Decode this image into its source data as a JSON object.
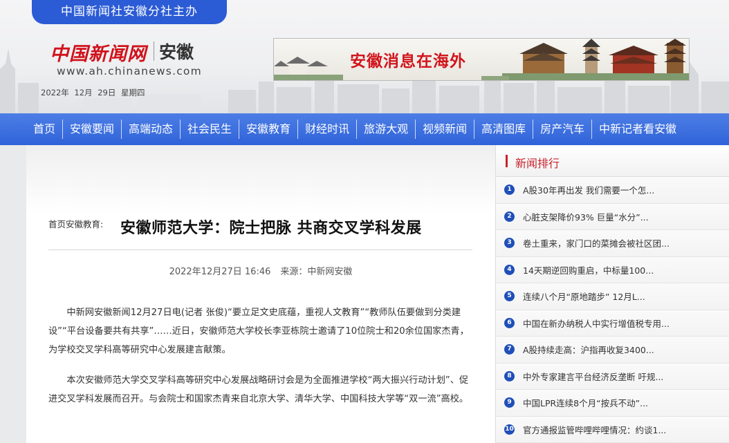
{
  "header": {
    "host_label": "中国新闻社安徽分社主办",
    "logo_cn": "中国新闻网",
    "logo_region": "安徽",
    "logo_url": "www.ah.chinanews.com",
    "date": "2022年 12月 29日",
    "weekday": "星期四"
  },
  "banner": {
    "text": "安徽消息在海外"
  },
  "nav": {
    "items": [
      {
        "label": "首页"
      },
      {
        "label": "安徽要闻"
      },
      {
        "label": "高端动态"
      },
      {
        "label": "社会民生"
      },
      {
        "label": "安徽教育"
      },
      {
        "label": "财经时讯"
      },
      {
        "label": "旅游大观"
      },
      {
        "label": "视频新闻"
      },
      {
        "label": "高清图库"
      },
      {
        "label": "房产汽车"
      },
      {
        "label": "中新记者看安徽"
      }
    ]
  },
  "article": {
    "breadcrumb_home": "首页",
    "breadcrumb_section": "安徽教育",
    "breadcrumb_sep": ":",
    "title": "安徽师范大学：院士把脉 共商交叉学科发展",
    "datetime": "2022年12月27日 16:46",
    "source": "来源：中新网安徽",
    "paragraphs": [
      "中新网安徽新闻12月27日电(记者 张俊)“要立足文史底蕴，重视人文教育”“教师队伍要做到分类建设”“平台设备要共有共享”……近日，安徽师范大学校长李亚栋院士邀请了10位院士和20余位国家杰青，为学校交叉学科高等研究中心发展建言献策。",
      "本次安徽师范大学交叉学科高等研究中心发展战略研讨会是为全面推进学校“两大振兴行动计划”、促进交叉学科发展而召开。与会院士和国家杰青来自北京大学、清华大学、中国科技大学等“双一流”高校。"
    ]
  },
  "sidebar": {
    "title": "新闻排行",
    "items": [
      {
        "num": "1",
        "text": "A股30年再出发 我们需要一个怎..."
      },
      {
        "num": "2",
        "text": "心脏支架降价93% 巨量“水分”..."
      },
      {
        "num": "3",
        "text": "卷土重来，家门口的菜摊会被社区团..."
      },
      {
        "num": "4",
        "text": "14天期逆回购重启，中标量100..."
      },
      {
        "num": "5",
        "text": "连续八个月“原地踏步” 12月L..."
      },
      {
        "num": "6",
        "text": "中国在新办纳税人中实行增值税专用..."
      },
      {
        "num": "7",
        "text": "A股持续走高：沪指再收复3400..."
      },
      {
        "num": "8",
        "text": "中外专家建言平台经济反垄断 吁规..."
      },
      {
        "num": "9",
        "text": "中国LPR连续8个月“按兵不动”..."
      },
      {
        "num": "10",
        "text": "官方通报监管哔哩哔哩情况：约谈1..."
      }
    ]
  },
  "colors": {
    "nav_blue": "#2f63d8",
    "brand_red": "#d0121b",
    "rank_badge": "#1f4fb8"
  }
}
